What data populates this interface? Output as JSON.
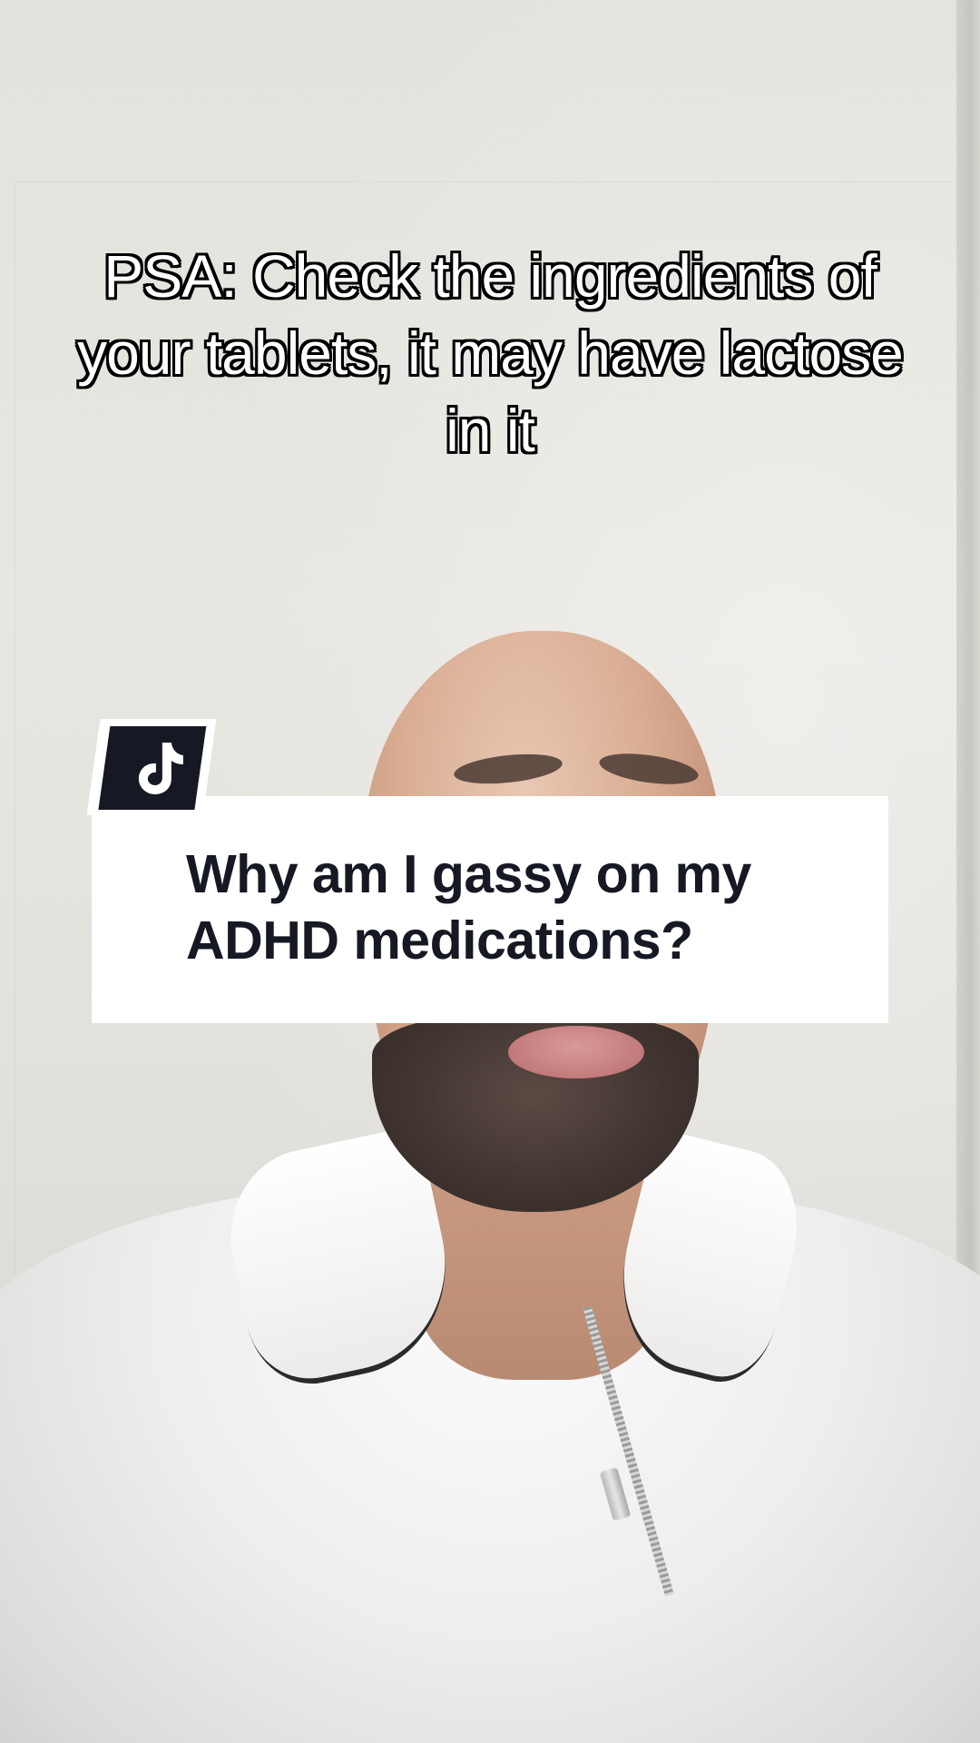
{
  "caption": {
    "text": "PSA: Check the ingredients of your tablets, it may have lactose in it"
  },
  "reply_card": {
    "question": "Why am I gassy on my ADHD medications?",
    "icon": "tiktok-logo-icon"
  },
  "colors": {
    "card_background": "#ffffff",
    "card_text": "#161823",
    "caption_fill": "#ffffff",
    "caption_outline": "#000000"
  }
}
